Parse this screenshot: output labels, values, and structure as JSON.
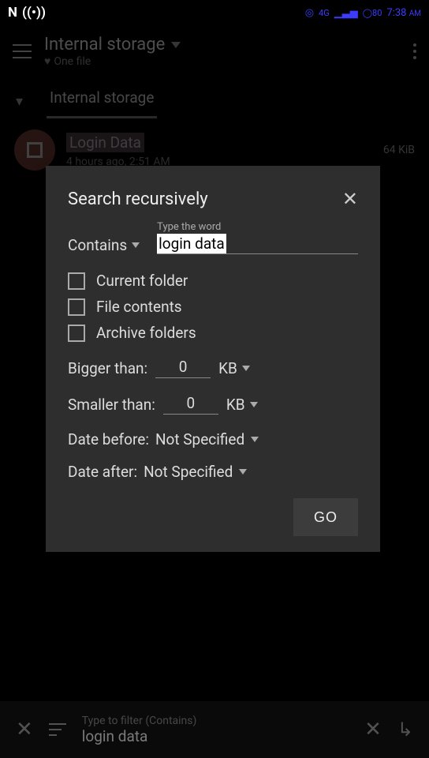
{
  "statusbar": {
    "left_letter": "N",
    "signal": "4G",
    "battery": "80",
    "time": "7:38",
    "ampm": "AM"
  },
  "appbar": {
    "title": "Internal storage",
    "subtitle": "One file"
  },
  "tabs": {
    "crumb": "Internal storage"
  },
  "file": {
    "name": "Login Data",
    "meta": "4 hours ago, 2:51 AM",
    "size": "64 KiB"
  },
  "dialog": {
    "title": "Search recursively",
    "contains_label": "Contains",
    "input_label": "Type the word",
    "input_value": "login data",
    "checks": {
      "current": "Current folder",
      "contents": "File contents",
      "archive": "Archive folders"
    },
    "bigger_label": "Bigger than:",
    "bigger_value": "0",
    "bigger_unit": "KB",
    "smaller_label": "Smaller than:",
    "smaller_value": "0",
    "smaller_unit": "KB",
    "date_before_label": "Date before:",
    "date_before_value": "Not Specified",
    "date_after_label": "Date after:",
    "date_after_value": "Not Specified",
    "go": "GO"
  },
  "bottombar": {
    "hint": "Type to filter (Contains)",
    "value": "login data"
  }
}
